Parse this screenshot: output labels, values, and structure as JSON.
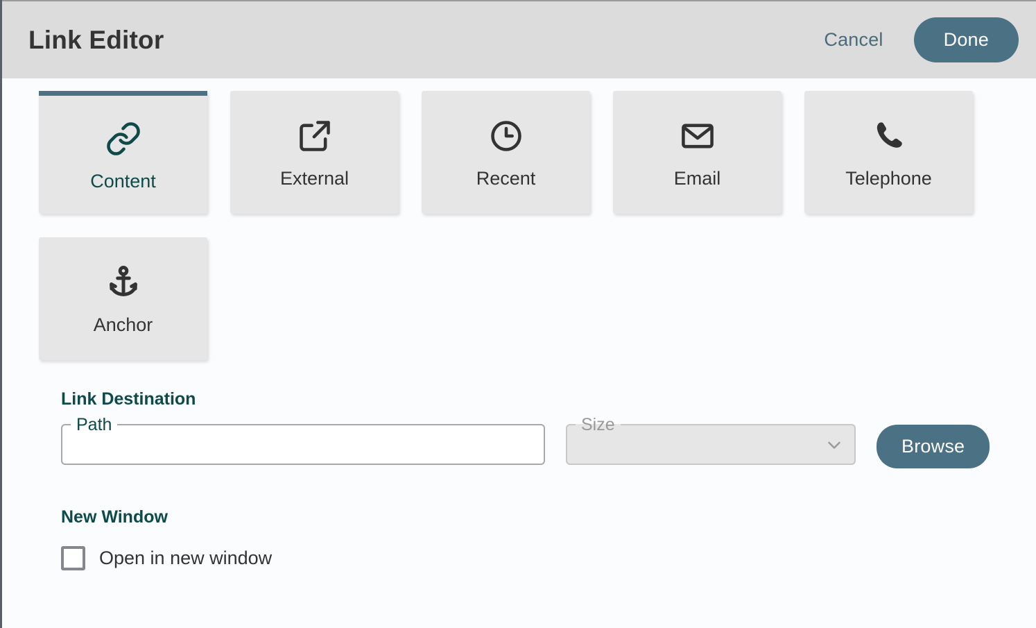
{
  "header": {
    "title": "Link Editor",
    "cancel_label": "Cancel",
    "done_label": "Done"
  },
  "tabs": [
    {
      "label": "Content",
      "icon": "link-icon",
      "active": true
    },
    {
      "label": "External",
      "icon": "external-link-icon",
      "active": false
    },
    {
      "label": "Recent",
      "icon": "clock-icon",
      "active": false
    },
    {
      "label": "Email",
      "icon": "envelope-icon",
      "active": false
    },
    {
      "label": "Telephone",
      "icon": "phone-icon",
      "active": false
    },
    {
      "label": "Anchor",
      "icon": "anchor-icon",
      "active": false
    }
  ],
  "link_destination": {
    "heading": "Link Destination",
    "path": {
      "label": "Path",
      "value": "",
      "placeholder": ""
    },
    "size": {
      "label": "Size",
      "value": "",
      "disabled": true,
      "icon": "chevron-down-icon"
    },
    "browse_label": "Browse"
  },
  "new_window": {
    "heading": "New Window",
    "checkbox_label": "Open in new window",
    "checked": false
  },
  "colors": {
    "accent": "#4b7184",
    "heading_teal": "#0e4a4a",
    "header_bg": "#dcdcdc",
    "tab_bg": "#e6e6e6",
    "body_bg": "#fbfcfe",
    "text": "#333333",
    "muted": "#9a9a9a"
  }
}
